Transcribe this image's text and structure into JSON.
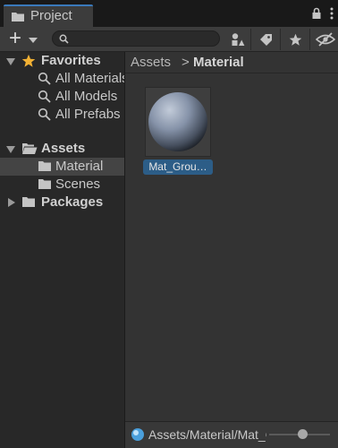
{
  "window": {
    "tab_title": "Project",
    "tab_icon": "folder-icon",
    "tab_tools": [
      "lock-icon",
      "more-options-icon"
    ]
  },
  "toolbar": {
    "add_label": "+",
    "search": {
      "value": "",
      "placeholder": ""
    },
    "buttons": [
      "filter-by-type-icon",
      "filter-by-label-icon",
      "favorite-star-icon",
      "hidden-packages-icon"
    ]
  },
  "tree": {
    "favorites": {
      "label": "Favorites",
      "items": [
        "All Materials",
        "All Models",
        "All Prefabs"
      ]
    },
    "assets": {
      "label": "Assets",
      "children": [
        "Material",
        "Scenes"
      ],
      "selected": "Material"
    },
    "packages": {
      "label": "Packages"
    }
  },
  "content": {
    "breadcrumb": {
      "root": "Assets",
      "separator": ">",
      "current": "Material"
    },
    "assets": [
      {
        "name": "Mat_Grou…",
        "type": "material-sphere-icon",
        "selected": true
      }
    ]
  },
  "footer": {
    "selected_path": "Assets/Material/Mat_Ground.mat",
    "zoom_level": 0.55
  },
  "colors": {
    "tab_accent": "#3a79bb",
    "selection": "#2c5d87",
    "favorites_star": "#f2b134"
  }
}
